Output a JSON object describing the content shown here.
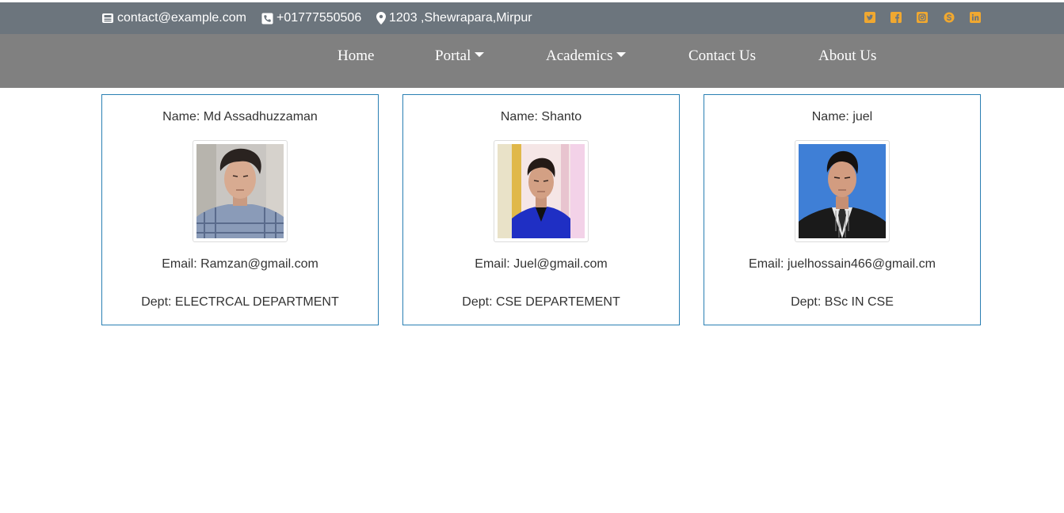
{
  "topbar": {
    "email": "contact@example.com",
    "phone": "+01777550506",
    "address": "1203 ,Shewrapara,Mirpur",
    "social_icons": [
      "twitter-icon",
      "facebook-icon",
      "instagram-icon",
      "skype-icon",
      "linkedin-icon"
    ],
    "social_color": "#f0a830",
    "background": "#6c757d"
  },
  "nav": {
    "background": "#808080",
    "items": [
      {
        "label": "Home"
      },
      {
        "label": "Portal"
      },
      {
        "label": "Academics"
      },
      {
        "label": "Contact Us"
      },
      {
        "label": "About Us"
      }
    ]
  },
  "cards": [
    {
      "name": "Name: Md Assadhuzzaman",
      "email": "Email: Ramzan@gmail.com",
      "dept": "Dept: ELECTRCAL DEPARTMENT"
    },
    {
      "name": "Name: Shanto",
      "email": "Email: Juel@gmail.com",
      "dept": "Dept: CSE DEPARTEMENT"
    },
    {
      "name": "Name: juel",
      "email": "Email: juelhossain466@gmail.cm",
      "dept": "Dept: BSc IN CSE"
    }
  ],
  "card_border_color": "#2a7fb3"
}
